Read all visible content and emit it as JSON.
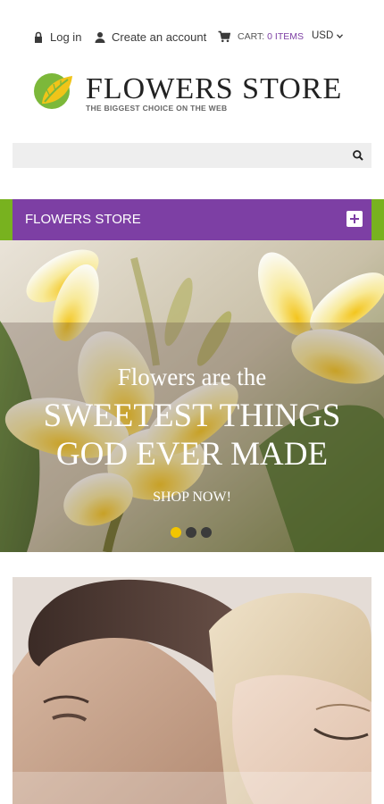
{
  "topbar": {
    "login_label": "Log in",
    "create_account_label": "Create an account",
    "cart_label": "CART:",
    "cart_count": "0 ITEMS",
    "currency": "USD"
  },
  "logo": {
    "name": "FLOWERS STORE",
    "tagline": "THE BIGGEST CHOICE ON THE WEB"
  },
  "search": {
    "placeholder": "",
    "value": ""
  },
  "menu": {
    "label": "FLOWERS STORE"
  },
  "slider": {
    "line1": "Flowers are the",
    "line2": "SWEETEST THINGS",
    "line3": "GOD EVER MADE",
    "cta": "SHOP NOW!",
    "active_index": 0,
    "total_slides": 3
  },
  "colors": {
    "accent_purple": "#7d3fa4",
    "accent_green": "#78b21f",
    "dot_active": "#f2c500"
  },
  "icons": [
    "lock-icon",
    "user-icon",
    "cart-icon",
    "chevron-down-icon",
    "search-icon",
    "plus-icon",
    "logo-leaf-icon"
  ]
}
